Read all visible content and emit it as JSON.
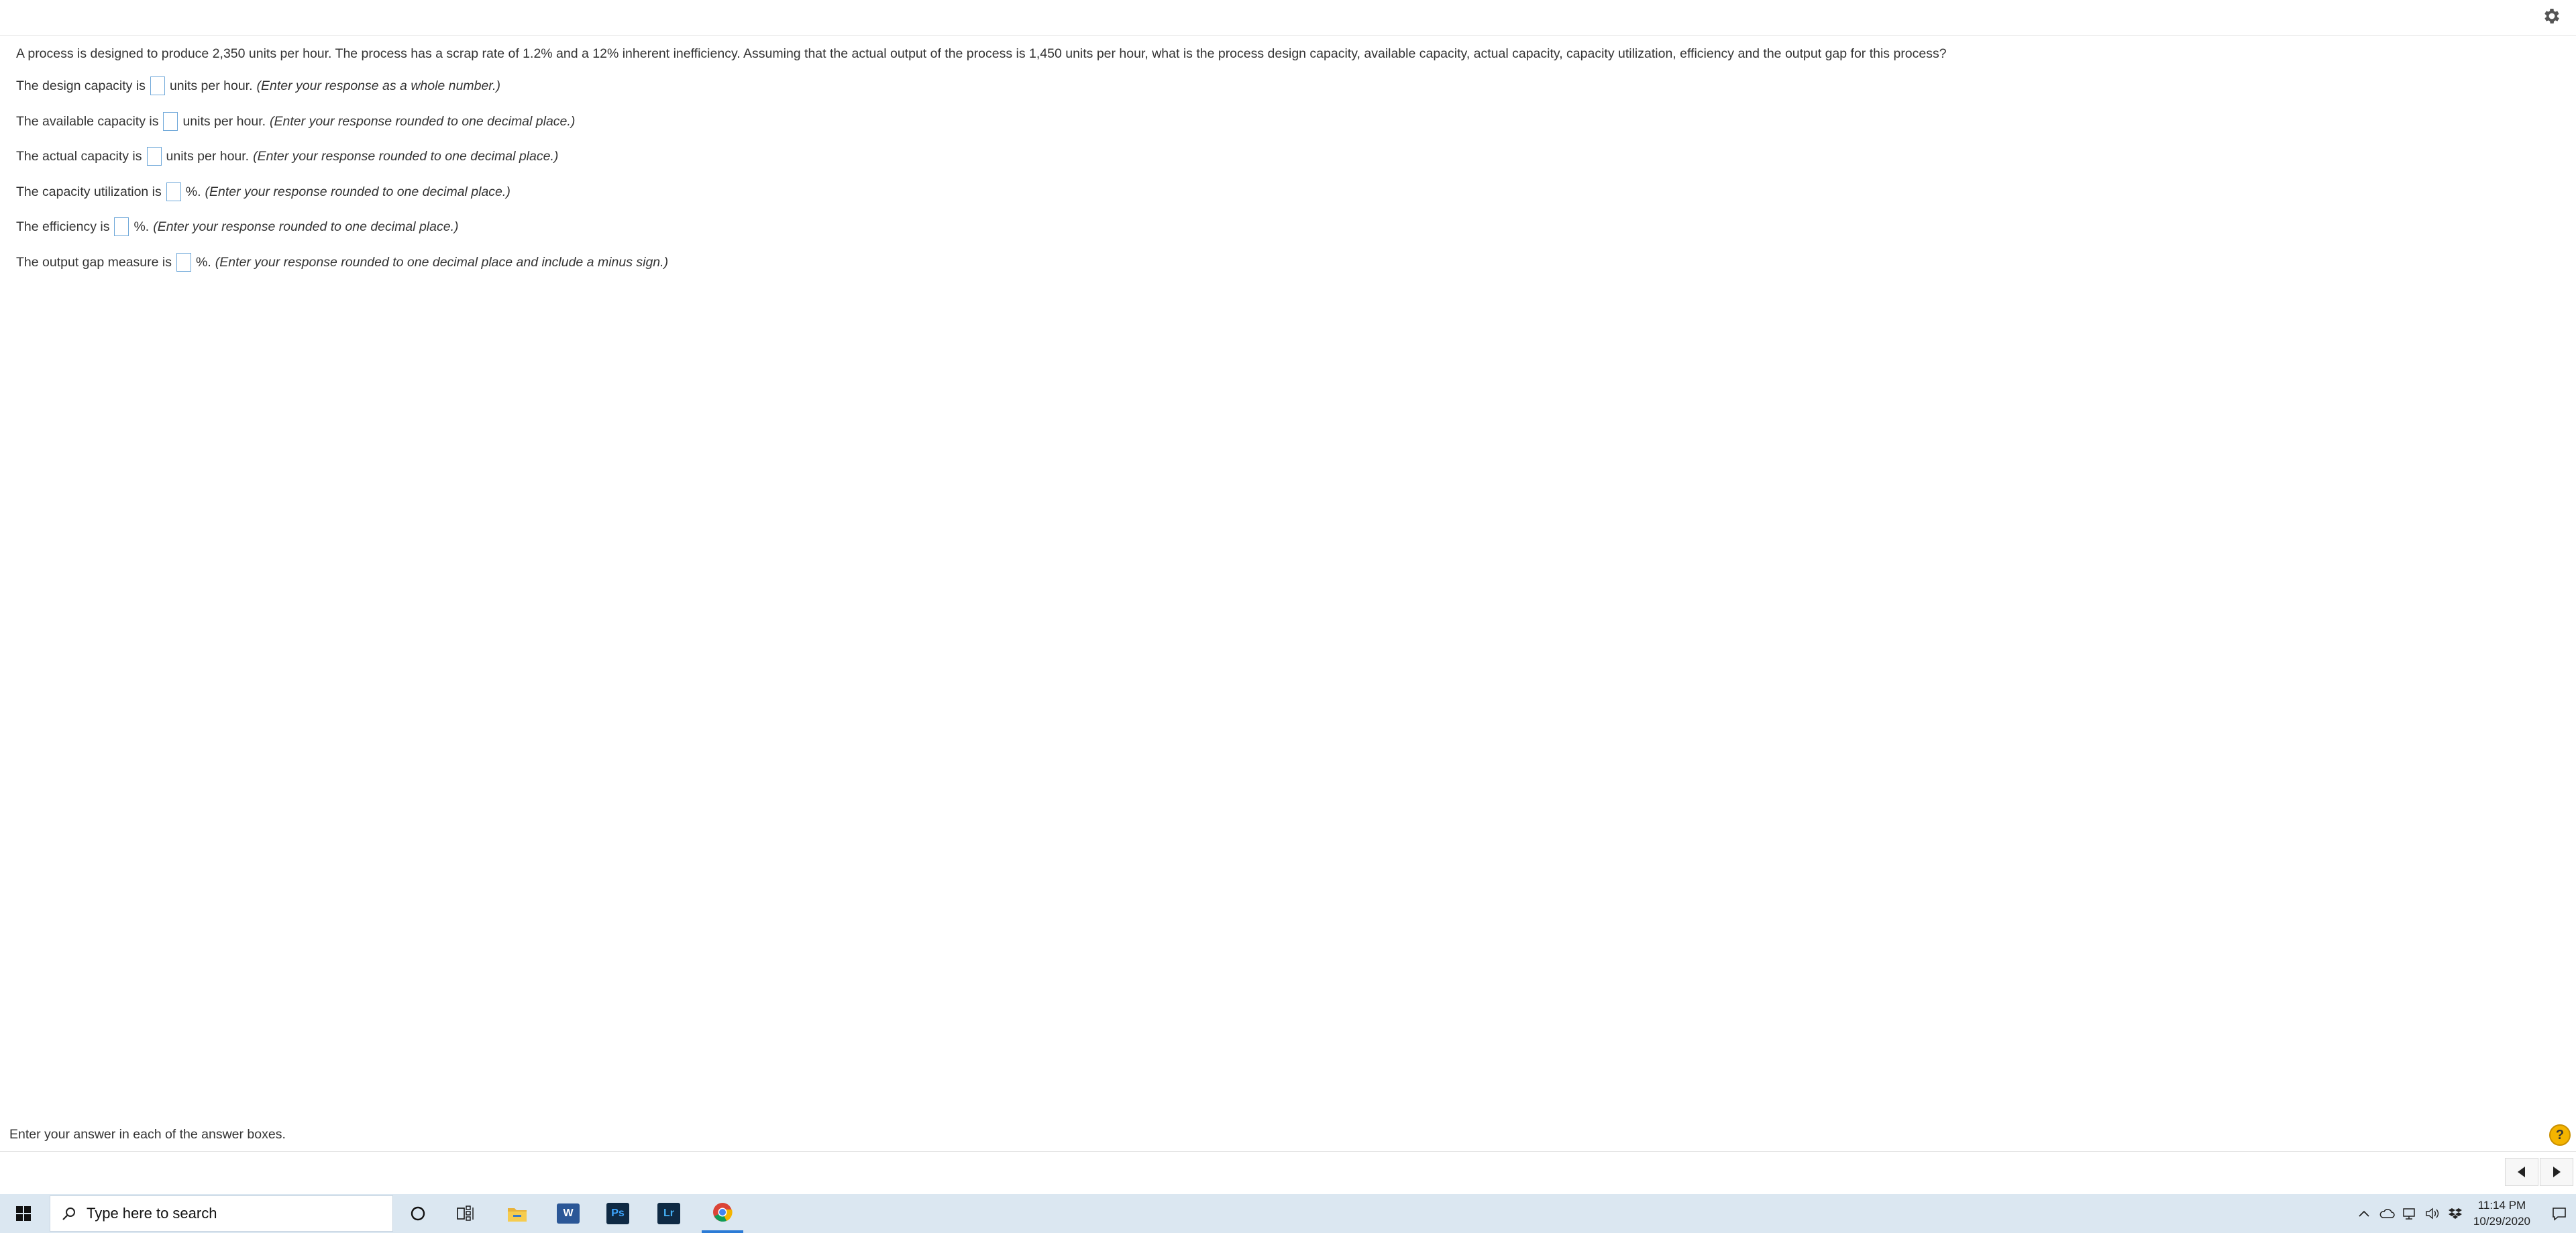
{
  "question": {
    "text": "A process is designed to produce 2,350 units per hour. The process has a scrap rate of 1.2% and a 12% inherent inefficiency. Assuming that the actual output of the process is 1,450 units per hour, what is the process design capacity, available capacity, actual capacity, capacity utilization, efficiency and the output gap for this process?",
    "rows": [
      {
        "prefix": "The design capacity is",
        "suffix": "units per hour.",
        "hint": "(Enter your response as a whole number.)"
      },
      {
        "prefix": "The available capacity is",
        "suffix": "units per hour.",
        "hint": "(Enter your response rounded to one decimal place.)"
      },
      {
        "prefix": "The actual capacity is",
        "suffix": "units per hour.",
        "hint": "(Enter your response rounded to one decimal place.)"
      },
      {
        "prefix": "The capacity utilization is",
        "suffix": "%.",
        "hint": "(Enter your response rounded to one decimal place.)"
      },
      {
        "prefix": "The efficiency is",
        "suffix": "%.",
        "hint": "(Enter your response rounded to one decimal place.)"
      },
      {
        "prefix": "The output gap measure is",
        "suffix": "%.",
        "hint": "(Enter your response rounded to one decimal place and include a minus sign.)"
      }
    ]
  },
  "footer": {
    "message": "Enter your answer in each of the answer boxes.",
    "help_label": "?"
  },
  "taskbar": {
    "search_placeholder": "Type here to search",
    "apps": [
      {
        "name": "cortana-icon"
      },
      {
        "name": "task-view-icon"
      },
      {
        "name": "file-explorer-icon"
      },
      {
        "name": "word-icon",
        "label": "W"
      },
      {
        "name": "photoshop-icon",
        "label": "Ps"
      },
      {
        "name": "lightroom-icon",
        "label": "Lr"
      },
      {
        "name": "chrome-icon"
      }
    ],
    "time": "11:14 PM",
    "date": "10/29/2020"
  },
  "colors": {
    "accent": "#2b7bd6",
    "answer_box_border": "#6fa8d9",
    "help_badge": "#f4b400",
    "taskbar_bg": "#dbe7f1"
  }
}
